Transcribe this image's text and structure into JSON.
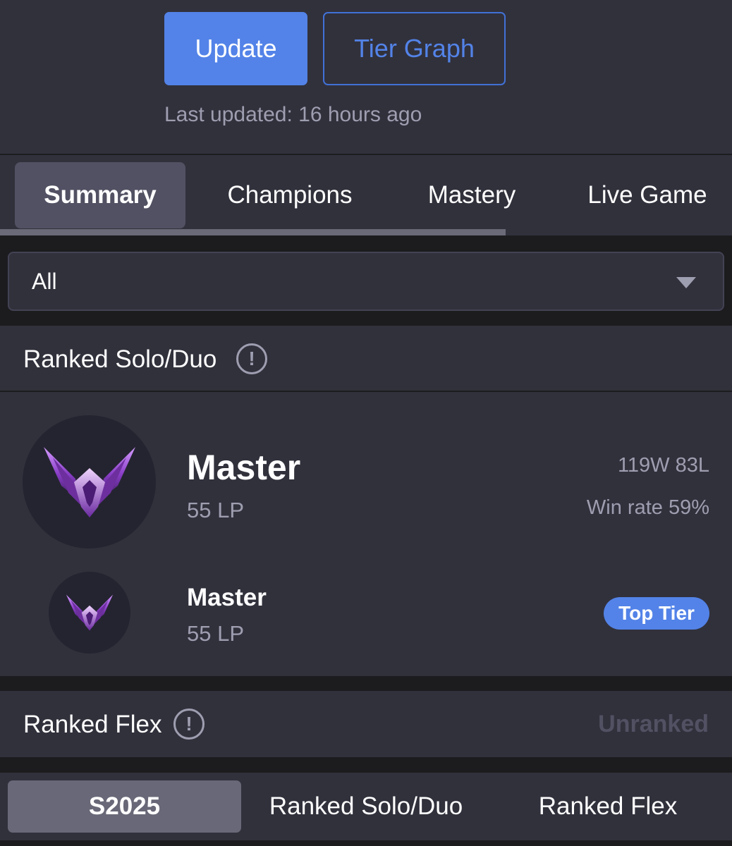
{
  "header": {
    "update_label": "Update",
    "tier_graph_label": "Tier Graph",
    "last_updated": "Last updated: 16 hours ago"
  },
  "tabs": [
    {
      "label": "Summary",
      "active": true
    },
    {
      "label": "Champions",
      "active": false
    },
    {
      "label": "Mastery",
      "active": false
    },
    {
      "label": "Live Game",
      "active": false
    }
  ],
  "filter": {
    "selected": "All"
  },
  "ranked_solo": {
    "title": "Ranked Solo/Duo",
    "current": {
      "tier": "Master",
      "lp": "55 LP",
      "record": "119W 83L",
      "win_rate": "Win rate 59%"
    },
    "peak": {
      "tier": "Master",
      "lp": "55 LP",
      "badge": "Top Tier"
    }
  },
  "ranked_flex": {
    "title": "Ranked Flex",
    "status": "Unranked"
  },
  "season_tabs": [
    {
      "label": "S2025",
      "active": true
    },
    {
      "label": "Ranked Solo/Duo",
      "active": false
    },
    {
      "label": "Ranked Flex",
      "active": false
    }
  ],
  "colors": {
    "accent": "#5383e8",
    "panel": "#31313c",
    "background": "#1c1c1f",
    "muted_text": "#9e9eb1"
  }
}
